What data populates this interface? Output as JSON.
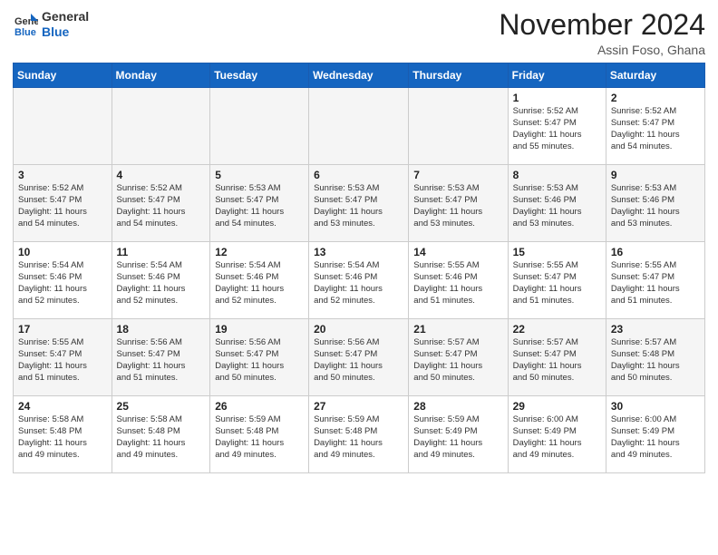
{
  "header": {
    "logo_line1": "General",
    "logo_line2": "Blue",
    "month_title": "November 2024",
    "location": "Assin Foso, Ghana"
  },
  "calendar": {
    "days_of_week": [
      "Sunday",
      "Monday",
      "Tuesday",
      "Wednesday",
      "Thursday",
      "Friday",
      "Saturday"
    ],
    "weeks": [
      [
        {
          "day": "",
          "info": ""
        },
        {
          "day": "",
          "info": ""
        },
        {
          "day": "",
          "info": ""
        },
        {
          "day": "",
          "info": ""
        },
        {
          "day": "",
          "info": ""
        },
        {
          "day": "1",
          "info": "Sunrise: 5:52 AM\nSunset: 5:47 PM\nDaylight: 11 hours\nand 55 minutes."
        },
        {
          "day": "2",
          "info": "Sunrise: 5:52 AM\nSunset: 5:47 PM\nDaylight: 11 hours\nand 54 minutes."
        }
      ],
      [
        {
          "day": "3",
          "info": "Sunrise: 5:52 AM\nSunset: 5:47 PM\nDaylight: 11 hours\nand 54 minutes."
        },
        {
          "day": "4",
          "info": "Sunrise: 5:52 AM\nSunset: 5:47 PM\nDaylight: 11 hours\nand 54 minutes."
        },
        {
          "day": "5",
          "info": "Sunrise: 5:53 AM\nSunset: 5:47 PM\nDaylight: 11 hours\nand 54 minutes."
        },
        {
          "day": "6",
          "info": "Sunrise: 5:53 AM\nSunset: 5:47 PM\nDaylight: 11 hours\nand 53 minutes."
        },
        {
          "day": "7",
          "info": "Sunrise: 5:53 AM\nSunset: 5:47 PM\nDaylight: 11 hours\nand 53 minutes."
        },
        {
          "day": "8",
          "info": "Sunrise: 5:53 AM\nSunset: 5:46 PM\nDaylight: 11 hours\nand 53 minutes."
        },
        {
          "day": "9",
          "info": "Sunrise: 5:53 AM\nSunset: 5:46 PM\nDaylight: 11 hours\nand 53 minutes."
        }
      ],
      [
        {
          "day": "10",
          "info": "Sunrise: 5:54 AM\nSunset: 5:46 PM\nDaylight: 11 hours\nand 52 minutes."
        },
        {
          "day": "11",
          "info": "Sunrise: 5:54 AM\nSunset: 5:46 PM\nDaylight: 11 hours\nand 52 minutes."
        },
        {
          "day": "12",
          "info": "Sunrise: 5:54 AM\nSunset: 5:46 PM\nDaylight: 11 hours\nand 52 minutes."
        },
        {
          "day": "13",
          "info": "Sunrise: 5:54 AM\nSunset: 5:46 PM\nDaylight: 11 hours\nand 52 minutes."
        },
        {
          "day": "14",
          "info": "Sunrise: 5:55 AM\nSunset: 5:46 PM\nDaylight: 11 hours\nand 51 minutes."
        },
        {
          "day": "15",
          "info": "Sunrise: 5:55 AM\nSunset: 5:47 PM\nDaylight: 11 hours\nand 51 minutes."
        },
        {
          "day": "16",
          "info": "Sunrise: 5:55 AM\nSunset: 5:47 PM\nDaylight: 11 hours\nand 51 minutes."
        }
      ],
      [
        {
          "day": "17",
          "info": "Sunrise: 5:55 AM\nSunset: 5:47 PM\nDaylight: 11 hours\nand 51 minutes."
        },
        {
          "day": "18",
          "info": "Sunrise: 5:56 AM\nSunset: 5:47 PM\nDaylight: 11 hours\nand 51 minutes."
        },
        {
          "day": "19",
          "info": "Sunrise: 5:56 AM\nSunset: 5:47 PM\nDaylight: 11 hours\nand 50 minutes."
        },
        {
          "day": "20",
          "info": "Sunrise: 5:56 AM\nSunset: 5:47 PM\nDaylight: 11 hours\nand 50 minutes."
        },
        {
          "day": "21",
          "info": "Sunrise: 5:57 AM\nSunset: 5:47 PM\nDaylight: 11 hours\nand 50 minutes."
        },
        {
          "day": "22",
          "info": "Sunrise: 5:57 AM\nSunset: 5:47 PM\nDaylight: 11 hours\nand 50 minutes."
        },
        {
          "day": "23",
          "info": "Sunrise: 5:57 AM\nSunset: 5:48 PM\nDaylight: 11 hours\nand 50 minutes."
        }
      ],
      [
        {
          "day": "24",
          "info": "Sunrise: 5:58 AM\nSunset: 5:48 PM\nDaylight: 11 hours\nand 49 minutes."
        },
        {
          "day": "25",
          "info": "Sunrise: 5:58 AM\nSunset: 5:48 PM\nDaylight: 11 hours\nand 49 minutes."
        },
        {
          "day": "26",
          "info": "Sunrise: 5:59 AM\nSunset: 5:48 PM\nDaylight: 11 hours\nand 49 minutes."
        },
        {
          "day": "27",
          "info": "Sunrise: 5:59 AM\nSunset: 5:48 PM\nDaylight: 11 hours\nand 49 minutes."
        },
        {
          "day": "28",
          "info": "Sunrise: 5:59 AM\nSunset: 5:49 PM\nDaylight: 11 hours\nand 49 minutes."
        },
        {
          "day": "29",
          "info": "Sunrise: 6:00 AM\nSunset: 5:49 PM\nDaylight: 11 hours\nand 49 minutes."
        },
        {
          "day": "30",
          "info": "Sunrise: 6:00 AM\nSunset: 5:49 PM\nDaylight: 11 hours\nand 49 minutes."
        }
      ]
    ]
  }
}
